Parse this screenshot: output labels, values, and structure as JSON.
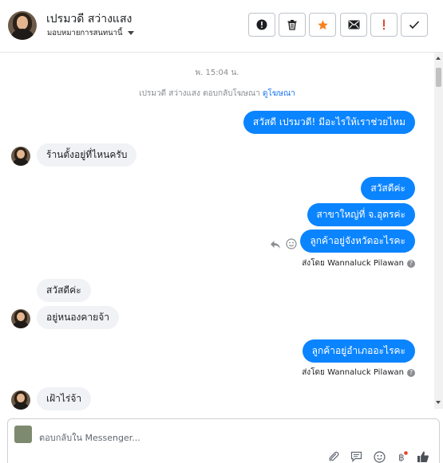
{
  "header": {
    "name": "เปรมวดี สว่างแสง",
    "subtitle": "มอบหมายการสนทนานี้",
    "buttons": [
      {
        "name": "spam-button",
        "icon": "exclamation-circle-icon"
      },
      {
        "name": "delete-button",
        "icon": "trash-icon"
      },
      {
        "name": "star-button",
        "icon": "star-icon"
      },
      {
        "name": "mark-unread-button",
        "icon": "envelope-icon"
      },
      {
        "name": "follow-up-button",
        "icon": "exclamation-icon"
      },
      {
        "name": "done-button",
        "icon": "check-icon"
      }
    ],
    "colors": {
      "star": "#f5831f",
      "followup": "#e4452b"
    }
  },
  "conversation": {
    "timestamp": "พ. 15:04 น.",
    "notice_text": "เปรมวดี สว่างแสง ตอบกลับโฆษณา",
    "notice_link": "ดูโฆษณา",
    "messages": [
      {
        "dir": "out",
        "text": "สวัสดี เปรมวดี! มีอะไรให้เราช่วยไหม"
      },
      {
        "dir": "in",
        "text": "ร้านตั้งอยู่ที่ไหนครับ"
      },
      {
        "dir": "out",
        "text": "สวัสดีค่ะ"
      },
      {
        "dir": "out",
        "text": "สาขาใหญ่ที่ จ.อุดรค่ะ"
      },
      {
        "dir": "out",
        "text": "ลูกค้าอยู่จังหวัดอะไรคะ"
      },
      {
        "dir": "in",
        "text": "สวัสดีค่ะ"
      },
      {
        "dir": "in",
        "text": "อยู่หนองคายจ้า"
      },
      {
        "dir": "out",
        "text": "ลูกค้าอยู่อำเภออะไรคะ"
      },
      {
        "dir": "in",
        "text": "เฝ้าไร่จ้า"
      }
    ],
    "sent_by_1": "ส่งโดย Wannaluck Pilawan",
    "sent_by_2": "ส่งโดย Wannaluck Pilawan",
    "bubble_color": "#0b84ff"
  },
  "composer": {
    "placeholder": "ตอบกลับใน Messenger..."
  }
}
